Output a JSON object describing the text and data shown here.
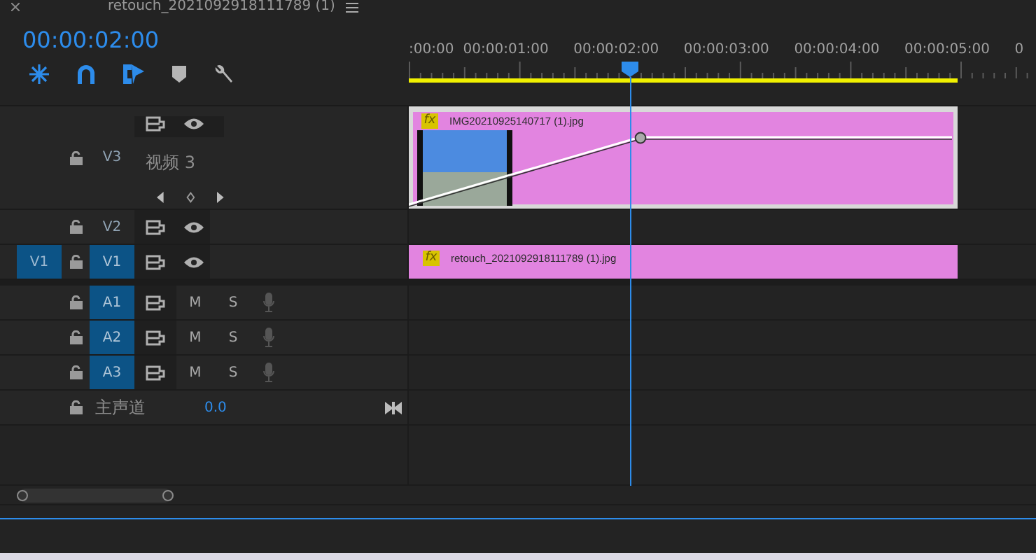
{
  "panel": {
    "title": "retouch_2021092918111789 (1)",
    "timecode": "00:00:02:00"
  },
  "toolbar": [
    {
      "kind": "nest",
      "on": true
    },
    {
      "kind": "snap",
      "on": true
    },
    {
      "kind": "linked",
      "on": true
    },
    {
      "kind": "marker",
      "on": false
    },
    {
      "kind": "wrench",
      "on": false
    }
  ],
  "ruler": {
    "labels": [
      ":00:00",
      "00:00:01:00",
      "00:00:02:00",
      "00:00:03:00",
      "00:00:04:00",
      "00:00:05:00",
      "0"
    ]
  },
  "tracks": [
    {
      "kind": "video",
      "label": "V3",
      "targeted": false,
      "expanded": true,
      "name": "视频 3",
      "clips": [
        {
          "name": "IMG20210925140717 (1).jpg",
          "fx": "fx",
          "selected": true
        }
      ]
    },
    {
      "kind": "video",
      "label": "V2",
      "targeted": false,
      "expanded": false
    },
    {
      "kind": "video",
      "label": "V1",
      "source_patch": "V1",
      "targeted": true,
      "expanded": false,
      "clips": [
        {
          "name": "retouch_2021092918111789 (1).jpg",
          "fx": "fx",
          "selected": false
        }
      ]
    },
    {
      "kind": "audio",
      "label": "A1",
      "targeted": true,
      "mute": "M",
      "solo": "S"
    },
    {
      "kind": "audio",
      "label": "A2",
      "targeted": true,
      "mute": "M",
      "solo": "S"
    },
    {
      "kind": "audio",
      "label": "A3",
      "targeted": true,
      "mute": "M",
      "solo": "S"
    },
    {
      "kind": "master",
      "name": "主声道",
      "value": "0.0"
    }
  ]
}
